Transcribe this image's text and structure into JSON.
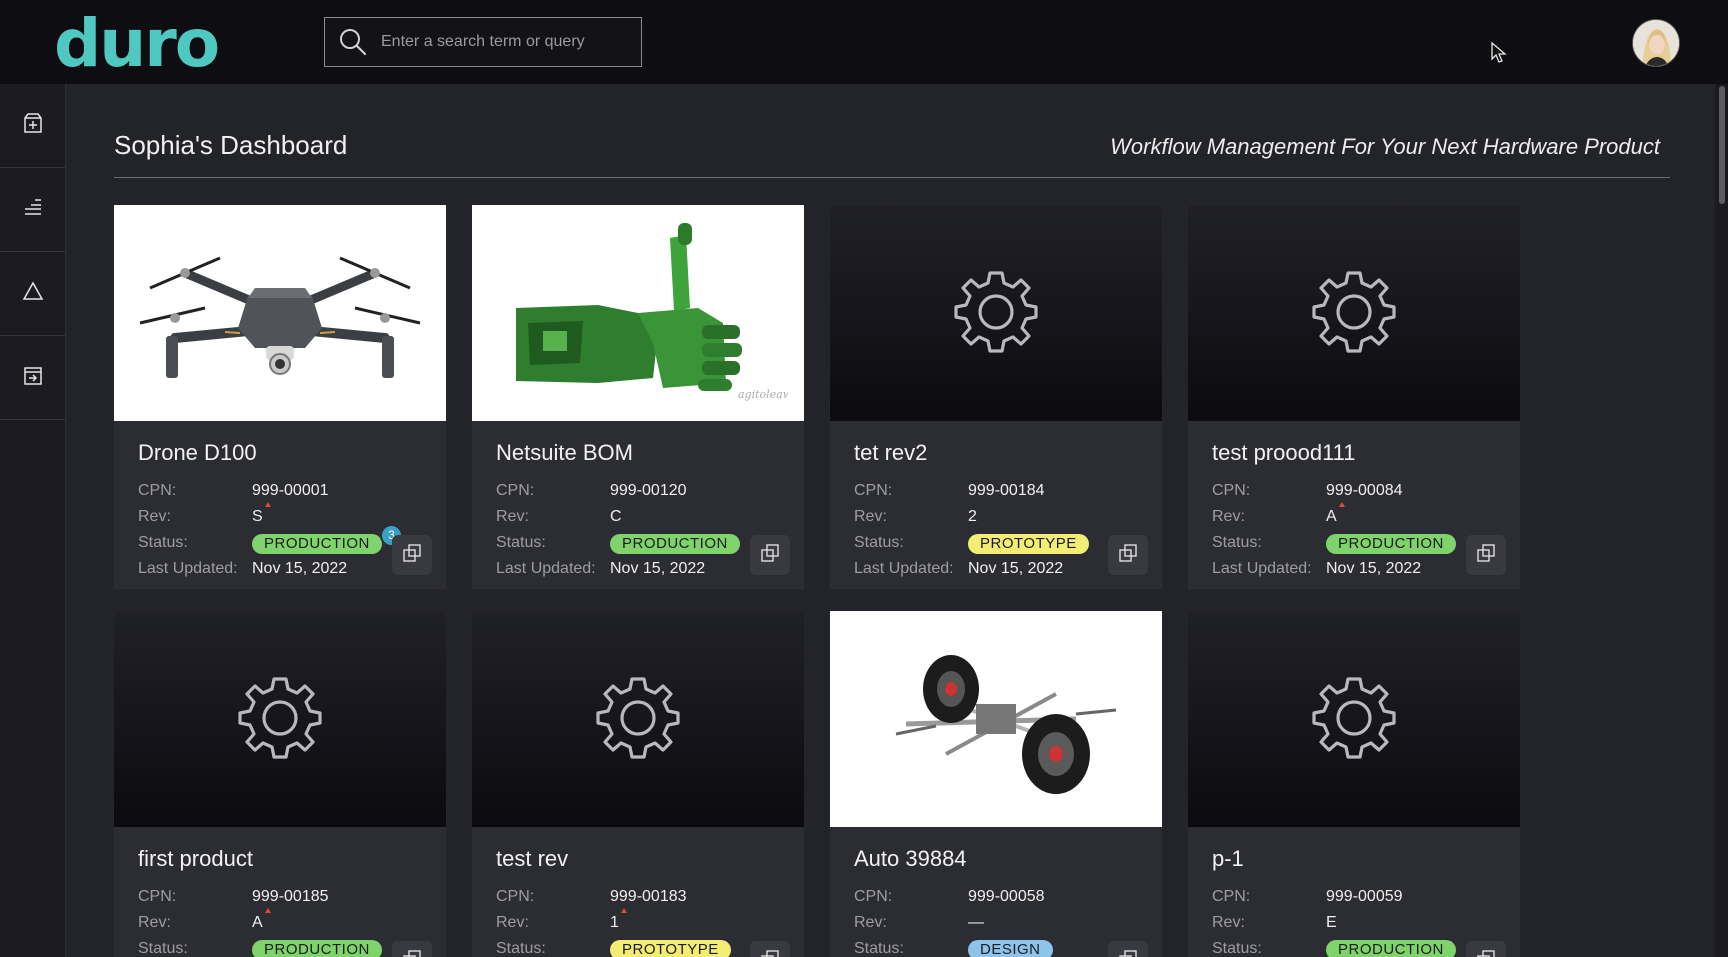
{
  "app": {
    "logo_text": "duro",
    "search_placeholder": "Enter a search term or query",
    "accent_color": "#4fc8c1"
  },
  "sidebar": {
    "items": [
      {
        "icon": "add-box-icon"
      },
      {
        "icon": "list-lines-icon"
      },
      {
        "icon": "triangle-alert-icon"
      },
      {
        "icon": "import-box-icon"
      }
    ]
  },
  "dashboard": {
    "title": "Sophia's Dashboard",
    "tagline": "Workflow Management For Your Next Hardware Product",
    "labels": {
      "cpn": "CPN:",
      "rev": "Rev:",
      "status": "Status:",
      "last_updated": "Last Updated:"
    }
  },
  "products": [
    {
      "name": "Drone D100",
      "cpn": "999-00001",
      "rev": "S",
      "rev_modified": true,
      "status": "PRODUCTION",
      "last_updated": "Nov 15, 2022",
      "image": "drone",
      "notification_count": "3"
    },
    {
      "name": "Netsuite BOM",
      "cpn": "999-00120",
      "rev": "C",
      "rev_modified": false,
      "status": "PRODUCTION",
      "last_updated": "Nov 15, 2022",
      "image": "robot-arm"
    },
    {
      "name": "tet rev2",
      "cpn": "999-00184",
      "rev": "2",
      "rev_modified": false,
      "status": "PROTOTYPE",
      "last_updated": "Nov 15, 2022",
      "image": "gear-placeholder"
    },
    {
      "name": "test proood111",
      "cpn": "999-00084",
      "rev": "A",
      "rev_modified": true,
      "status": "PRODUCTION",
      "last_updated": "Nov 15, 2022",
      "image": "gear-placeholder"
    },
    {
      "name": "first product",
      "cpn": "999-00185",
      "rev": "A",
      "rev_modified": true,
      "status": "PRODUCTION",
      "last_updated": "",
      "image": "gear-placeholder"
    },
    {
      "name": "test rev",
      "cpn": "999-00183",
      "rev": "1",
      "rev_modified": true,
      "status": "PROTOTYPE",
      "last_updated": "",
      "image": "gear-placeholder"
    },
    {
      "name": "Auto 39884",
      "cpn": "999-00058",
      "rev": "—",
      "rev_modified": false,
      "status": "DESIGN",
      "last_updated": "",
      "image": "suspension"
    },
    {
      "name": "p-1",
      "cpn": "999-00059",
      "rev": "E",
      "rev_modified": false,
      "status": "PRODUCTION",
      "last_updated": "",
      "image": "gear-placeholder"
    }
  ],
  "status_colors": {
    "PRODUCTION": "#7ed36b",
    "PROTOTYPE": "#f3ee73",
    "DESIGN": "#8ec3ec"
  }
}
